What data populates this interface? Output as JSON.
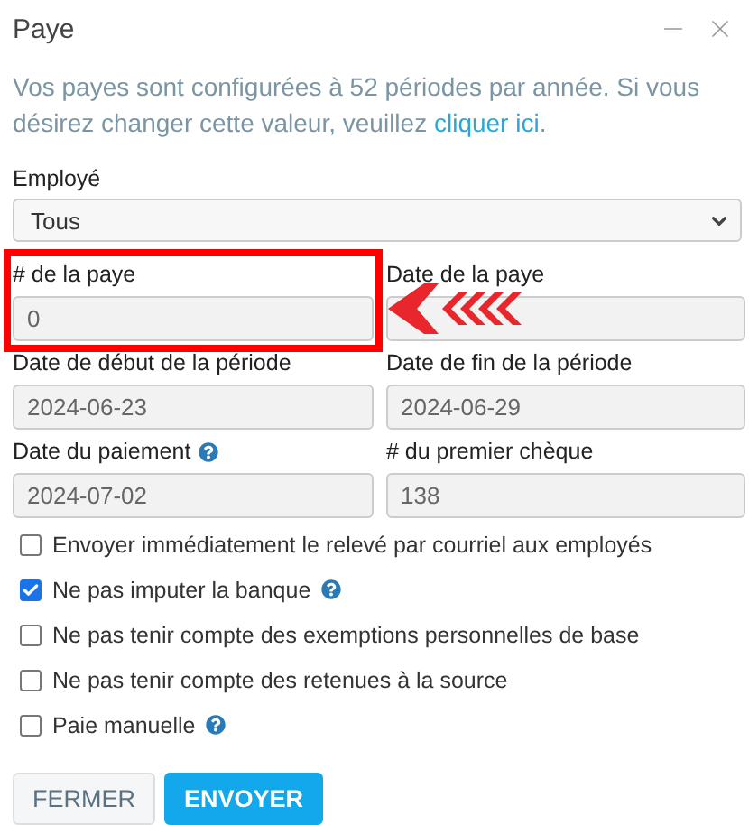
{
  "window": {
    "title": "Paye"
  },
  "intro": {
    "text": "Vos payes sont configurées à 52 périodes par année. Si vous désirez changer cette valeur, veuillez ",
    "link": "cliquer ici",
    "suffix": "."
  },
  "employee": {
    "label": "Employé",
    "value": "Tous"
  },
  "fields": [
    {
      "label": "# de la paye",
      "value": "0",
      "help": false,
      "highlighted": true
    },
    {
      "label": "Date de la paye",
      "help": false,
      "highlighted": false
    },
    {
      "label": "Date de début de la période",
      "value": "2024-06-23",
      "help": false,
      "highlighted": false
    },
    {
      "label": "Date de fin de la période",
      "value": "2024-06-29",
      "help": false,
      "highlighted": false
    },
    {
      "label": "Date du paiement",
      "value": "2024-07-02",
      "help": true,
      "highlighted": false
    },
    {
      "label": "# du premier chèque",
      "value": "138",
      "help": false,
      "highlighted": false
    }
  ],
  "options": [
    {
      "label": "Envoyer immédiatement le relevé par courriel aux employés",
      "checked": false,
      "help": false
    },
    {
      "label": "Ne pas imputer la banque",
      "checked": true,
      "help": true
    },
    {
      "label": "Ne pas tenir compte des exemptions personnelles de base",
      "checked": false,
      "help": false
    },
    {
      "label": "Ne pas tenir compte des retenues à la source",
      "checked": false,
      "help": false
    },
    {
      "label": "Paie manuelle",
      "checked": false,
      "help": true
    }
  ],
  "buttons": [
    {
      "label": "FERMER",
      "kind": "secondary"
    },
    {
      "label": "ENVOYER",
      "kind": "primary"
    }
  ]
}
